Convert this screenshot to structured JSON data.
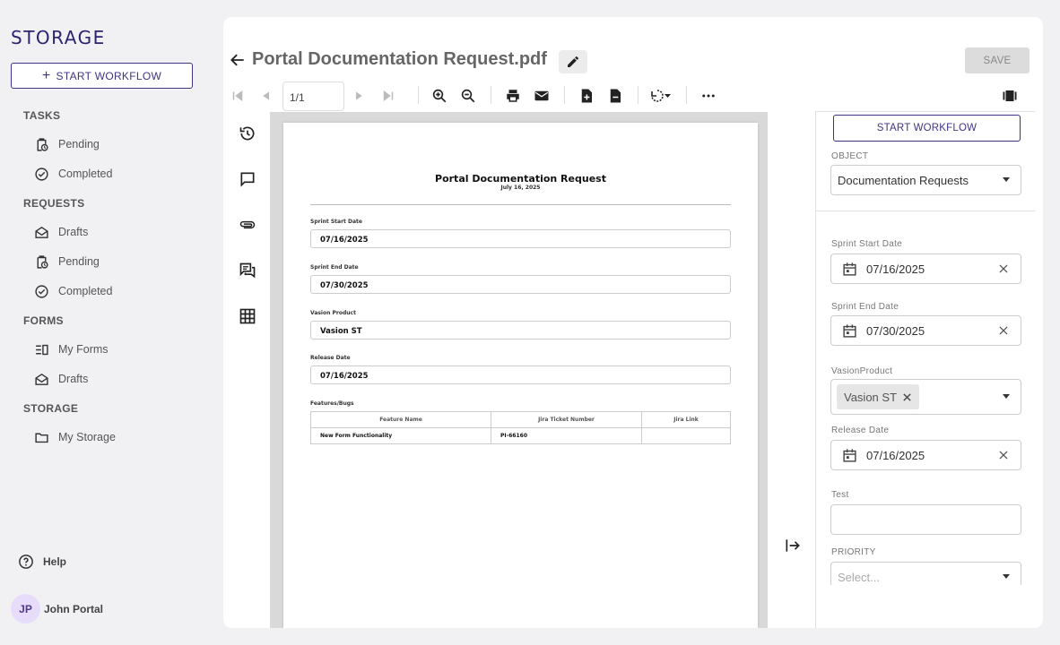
{
  "sidebar": {
    "logo": "STORAGE",
    "start_workflow": "START WORKFLOW",
    "sections": {
      "tasks": "TASKS",
      "requests": "REQUESTS",
      "forms": "FORMS",
      "storage": "STORAGE"
    },
    "items": {
      "tasks_pending": "Pending",
      "tasks_completed": "Completed",
      "requests_drafts": "Drafts",
      "requests_pending": "Pending",
      "requests_completed": "Completed",
      "forms_my_forms": "My Forms",
      "forms_drafts": "Drafts",
      "storage_my_storage": "My Storage"
    },
    "help": "Help",
    "user": {
      "initials": "JP",
      "name": "John Portal"
    }
  },
  "header": {
    "title": "Portal Documentation Request.pdf",
    "save": "SAVE"
  },
  "toolbar": {
    "page_value": "1/1"
  },
  "document": {
    "title": "Portal Documentation Request",
    "date": "July 16, 2025",
    "fields": {
      "sprint_start_label": "Sprint Start Date",
      "sprint_start_value": "07/16/2025",
      "sprint_end_label": "Sprint End Date",
      "sprint_end_value": "07/30/2025",
      "product_label": "Vasion Product",
      "product_value": "Vasion ST",
      "release_label": "Release Date",
      "release_value": "07/16/2025",
      "features_label": "Features/Bugs"
    },
    "table": {
      "headers": [
        "Feature Name",
        "Jira Ticket Number",
        "Jira Link"
      ],
      "rows": [
        [
          "New Form Functionality",
          "PI-66160",
          ""
        ]
      ]
    }
  },
  "panel": {
    "start_workflow": "START WORKFLOW",
    "object_label": "OBJECT",
    "object_value": "Documentation Requests",
    "sprint_start_label": "Sprint Start Date",
    "sprint_start_value": "07/16/2025",
    "sprint_end_label": "Sprint End Date",
    "sprint_end_value": "07/30/2025",
    "product_label": "VasionProduct",
    "product_chip": "Vasion ST",
    "release_label": "Release Date",
    "release_value": "07/16/2025",
    "test_label": "Test",
    "priority_label": "PRIORITY",
    "priority_placeholder": "Select..."
  }
}
